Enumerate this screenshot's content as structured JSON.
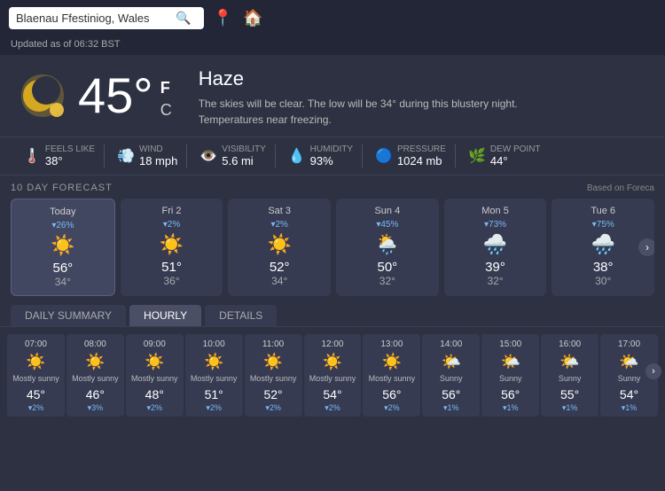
{
  "header": {
    "search_placeholder": "Blaenau Ffestiniog, Wales",
    "search_value": "Blaenau Ffestiniog, Wales"
  },
  "updated": {
    "text": "Updated as of 06:32 BST"
  },
  "current": {
    "temp": "45°",
    "unit_f": "F",
    "unit_c": "C",
    "condition": "Haze",
    "description": "The skies will be clear. The low will be 34° during this blustery night. Temperatures near freezing."
  },
  "stats": {
    "feels_like_label": "FEELS LIKE",
    "feels_like_value": "38°",
    "wind_label": "WIND",
    "wind_value": "18 mph",
    "visibility_label": "VISIBILITY",
    "visibility_value": "5.6 mi",
    "humidity_label": "HUMIDITY",
    "humidity_value": "93%",
    "pressure_label": "PRESSURE",
    "pressure_value": "1024 mb",
    "dew_point_label": "DEW POINT",
    "dew_point_value": "44°"
  },
  "forecast": {
    "title": "10 DAY FORECAST",
    "note": "Based on Foreca",
    "days": [
      {
        "label": "Today",
        "precip": "▾26%",
        "icon": "☀️",
        "high": "56°",
        "low": "34°",
        "active": true
      },
      {
        "label": "Fri 2",
        "precip": "▾2%",
        "icon": "☀️",
        "high": "51°",
        "low": "36°",
        "active": false
      },
      {
        "label": "Sat 3",
        "precip": "▾2%",
        "icon": "☀️",
        "high": "52°",
        "low": "34°",
        "active": false
      },
      {
        "label": "Sun 4",
        "precip": "▾45%",
        "icon": "🌦️",
        "high": "50°",
        "low": "32°",
        "active": false
      },
      {
        "label": "Mon 5",
        "precip": "▾73%",
        "icon": "🌧️",
        "high": "39°",
        "low": "32°",
        "active": false
      },
      {
        "label": "Tue 6",
        "precip": "▾75%",
        "icon": "🌧️",
        "high": "38°",
        "low": "30°",
        "active": false
      }
    ]
  },
  "tabs": {
    "items": [
      "DAILY SUMMARY",
      "HOURLY",
      "DETAILS"
    ],
    "active": "HOURLY"
  },
  "hourly": {
    "items": [
      {
        "time": "07:00",
        "icon": "☀️",
        "desc": "Mostly sunny",
        "temp": "45°",
        "precip": "▾2%"
      },
      {
        "time": "08:00",
        "icon": "☀️",
        "desc": "Mostly sunny",
        "temp": "46°",
        "precip": "▾3%"
      },
      {
        "time": "09:00",
        "icon": "☀️",
        "desc": "Mostly sunny",
        "temp": "48°",
        "precip": "▾2%"
      },
      {
        "time": "10:00",
        "icon": "☀️",
        "desc": "Mostly sunny",
        "temp": "51°",
        "precip": "▾2%"
      },
      {
        "time": "11:00",
        "icon": "☀️",
        "desc": "Mostly sunny",
        "temp": "52°",
        "precip": "▾2%"
      },
      {
        "time": "12:00",
        "icon": "☀️",
        "desc": "Mostly sunny",
        "temp": "54°",
        "precip": "▾2%"
      },
      {
        "time": "13:00",
        "icon": "☀️",
        "desc": "Mostly sunny",
        "temp": "56°",
        "precip": "▾2%"
      },
      {
        "time": "14:00",
        "icon": "🌤️",
        "desc": "Sunny",
        "temp": "56°",
        "precip": "▾1%"
      },
      {
        "time": "15:00",
        "icon": "🌤️",
        "desc": "Sunny",
        "temp": "56°",
        "precip": "▾1%"
      },
      {
        "time": "16:00",
        "icon": "🌤️",
        "desc": "Sunny",
        "temp": "55°",
        "precip": "▾1%"
      },
      {
        "time": "17:00",
        "icon": "🌤️",
        "desc": "Sunny",
        "temp": "54°",
        "precip": "▾1%"
      }
    ]
  }
}
